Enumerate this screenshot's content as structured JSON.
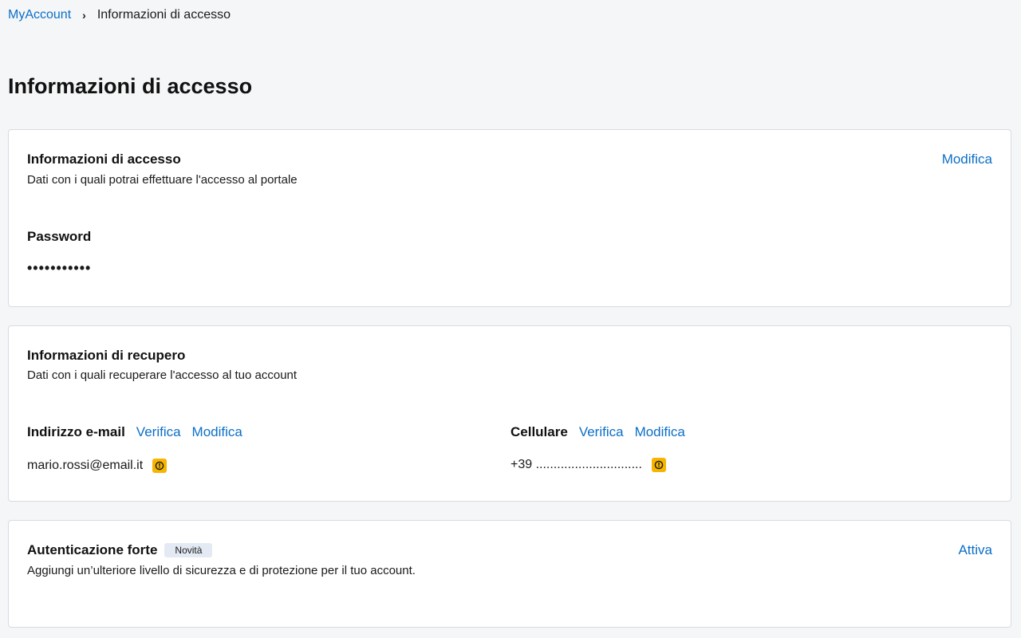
{
  "breadcrumb": {
    "root": "MyAccount",
    "separator": "›",
    "current": "Informazioni di accesso"
  },
  "page_title": "Informazioni di accesso",
  "access_card": {
    "title": "Informazioni di accesso",
    "subtitle": "Dati con i quali potrai effettuare l'accesso al portale",
    "edit_link": "Modifica",
    "password_label": "Password",
    "password_value": "•••••••••••"
  },
  "recovery_card": {
    "title": "Informazioni di recupero",
    "subtitle": "Dati con i quali recuperare l'accesso al tuo account",
    "email": {
      "label": "Indirizzo e-mail",
      "verify_link": "Verifica",
      "edit_link": "Modifica",
      "value": "mario.rossi@email.it",
      "icon": "warning-icon"
    },
    "phone": {
      "label": "Cellulare",
      "verify_link": "Verifica",
      "edit_link": "Modifica",
      "value": "+39 ..............................",
      "icon": "warning-icon"
    }
  },
  "strong_auth_card": {
    "title": "Autenticazione forte",
    "badge": "Novità",
    "subtitle": "Aggiungi un’ulteriore livello di sicurezza e di protezione per il tuo account.",
    "activate_link": "Attiva"
  },
  "colors": {
    "accent": "#0b6fc7",
    "warning": "#f7b500",
    "background": "#f5f6f8",
    "card": "#ffffff",
    "badge_bg": "#e3eaf3"
  }
}
